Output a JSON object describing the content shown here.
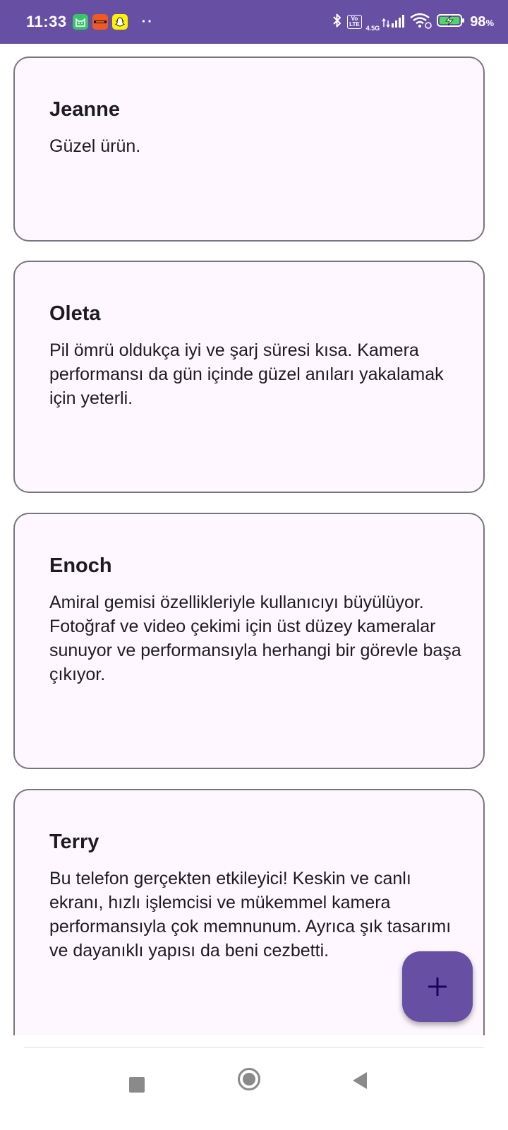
{
  "status_bar": {
    "time": "11:33",
    "notification_icons": [
      "cat-app-icon",
      "shopping-app-icon",
      "snapchat-icon"
    ],
    "more_indicator": "··",
    "network_type": "4.5G",
    "volte_label": "Vo LTE",
    "battery_percent": "98",
    "battery_unit": "%",
    "background_color": "#6750a4"
  },
  "reviews": [
    {
      "name": "Jeanne",
      "text": "Güzel ürün."
    },
    {
      "name": "Oleta",
      "text": "Pil ömrü oldukça iyi ve şarj süresi kısa. Kamera performansı da gün içinde güzel anıları yakalamak için yeterli."
    },
    {
      "name": "Enoch",
      "text": "Amiral gemisi özellikleriyle kullanıcıyı büyülüyor. Fotoğraf ve video çekimi için üst düzey kameralar sunuyor ve performansıyla herhangi bir görevle başa çıkıyor."
    },
    {
      "name": "Terry",
      "text": "Bu telefon gerçekten etkileyici! Keskin ve canlı ekranı, hızlı işlemcisi ve mükemmel kamera performansıyla çok memnunum. Ayrıca şık tasarımı ve dayanıklı yapısı da beni cezbetti."
    }
  ],
  "fab": {
    "icon": "plus-icon",
    "color": "#6750a4",
    "icon_color": "#21005d"
  },
  "nav_bar": {
    "buttons": [
      "recents-icon",
      "home-icon",
      "back-icon"
    ]
  },
  "colors": {
    "card_background": "#fef7ff",
    "card_border": "#79747e",
    "text": "#1d1b20"
  }
}
